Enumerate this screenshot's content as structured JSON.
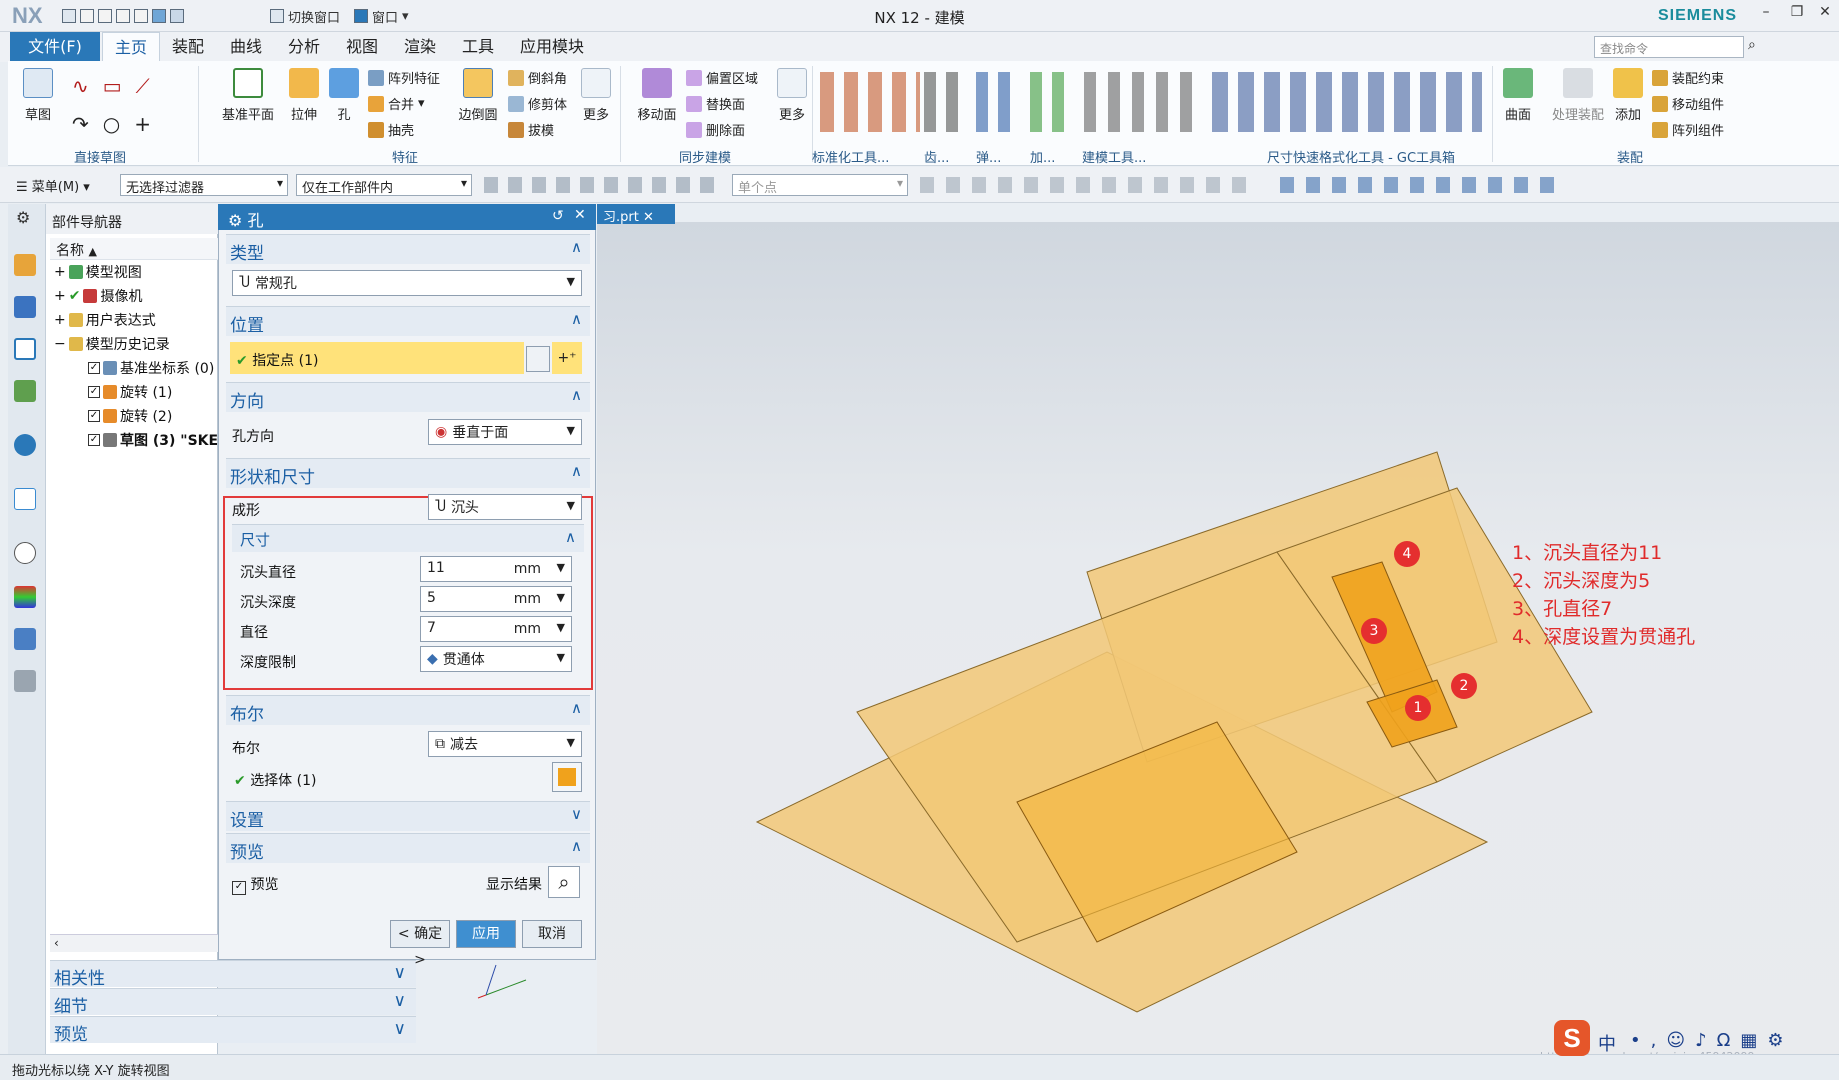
{
  "titlebar": {
    "app_logo": "NX",
    "title": "NX 12 - 建模",
    "brand": "SIEMENS",
    "switch_window": "切换窗口",
    "window_menu": "窗口"
  },
  "menu": {
    "file": "文件(F)",
    "tabs": [
      "主页",
      "装配",
      "曲线",
      "分析",
      "视图",
      "渲染",
      "工具",
      "应用模块"
    ],
    "search_placeholder": "查找命令"
  },
  "ribbon": {
    "groups": {
      "direct_sketch": "直接草图",
      "feature": "特征",
      "sync": "同步建模",
      "std": "标准化工具...",
      "gear": "齿...",
      "spring": "弹...",
      "add": "加...",
      "build": "建模工具...",
      "dimfmt": "尺寸快速格式化工具 - GC工具箱",
      "assembly": "装配"
    },
    "buttons": {
      "sketch": "草图",
      "datum_plane": "基准平面",
      "extrude": "拉伸",
      "hole": "孔",
      "pattern_feature": "阵列特征",
      "unite": "合并",
      "shell": "抽壳",
      "edge_blend": "边倒圆",
      "chamfer": "倒斜角",
      "trim_body": "修剪体",
      "draft": "拔模",
      "more": "更多",
      "move_face": "移动面",
      "offset_region": "偏置区域",
      "replace_face": "替换面",
      "delete_face": "删除面",
      "more2": "更多",
      "surface": "曲面",
      "process_asm": "处理装配",
      "add_comp": "添加",
      "asm_constraint": "装配约束",
      "move_comp": "移动组件",
      "pattern_comp": "阵列组件"
    }
  },
  "toolbar2": {
    "menu": "菜单(M)",
    "filter": "无选择过滤器",
    "scope": "仅在工作部件内",
    "snap": "单个点"
  },
  "navigator": {
    "title": "部件导航器",
    "col_name": "名称",
    "items": [
      "模型视图",
      "摄像机",
      "用户表达式",
      "模型历史记录",
      "基准坐标系 (0)",
      "旋转 (1)",
      "旋转 (2)",
      "草图 (3) \"SKE"
    ],
    "panels": [
      "相关性",
      "细节",
      "预览"
    ]
  },
  "dialog": {
    "title": "孔",
    "type": {
      "header": "类型",
      "value": "常规孔"
    },
    "position": {
      "header": "位置",
      "specify_point": "指定点 (1)"
    },
    "direction": {
      "header": "方向",
      "label": "孔方向",
      "value": "垂直于面"
    },
    "shape": {
      "header": "形状和尺寸",
      "form_label": "成形",
      "form_value": "沉头",
      "dims_header": "尺寸",
      "cbore_dia_label": "沉头直径",
      "cbore_dia": "11",
      "cbore_depth_label": "沉头深度",
      "cbore_depth": "5",
      "dia_label": "直径",
      "dia": "7",
      "unit": "mm",
      "depth_limit_label": "深度限制",
      "depth_limit": "贯通体"
    },
    "boolean": {
      "header": "布尔",
      "label": "布尔",
      "value": "减去",
      "select_body": "选择体 (1)"
    },
    "settings": {
      "header": "设置"
    },
    "preview": {
      "header": "预览",
      "checkbox": "预览",
      "show_result": "显示结果"
    },
    "buttons": {
      "ok": "< 确定 >",
      "apply": "应用",
      "cancel": "取消"
    }
  },
  "viewport": {
    "doc_tab": "习.prt",
    "notes": [
      "1、沉头直径为11",
      "2、沉头深度为5",
      "3、孔直径7",
      "4、深度设置为贯通孔"
    ],
    "markers": [
      "1",
      "2",
      "3",
      "4"
    ],
    "watermark": "https://blog.csdn.net/weixin_45942099"
  },
  "status": {
    "text": "拖动光标以绕 X-Y 旋转视图"
  },
  "tray": {
    "ime": "中"
  },
  "colors": {
    "accent": "#2a78b8",
    "highlight": "#ffe27a",
    "annotation": "#e02b2b",
    "part": "#f2c877"
  }
}
